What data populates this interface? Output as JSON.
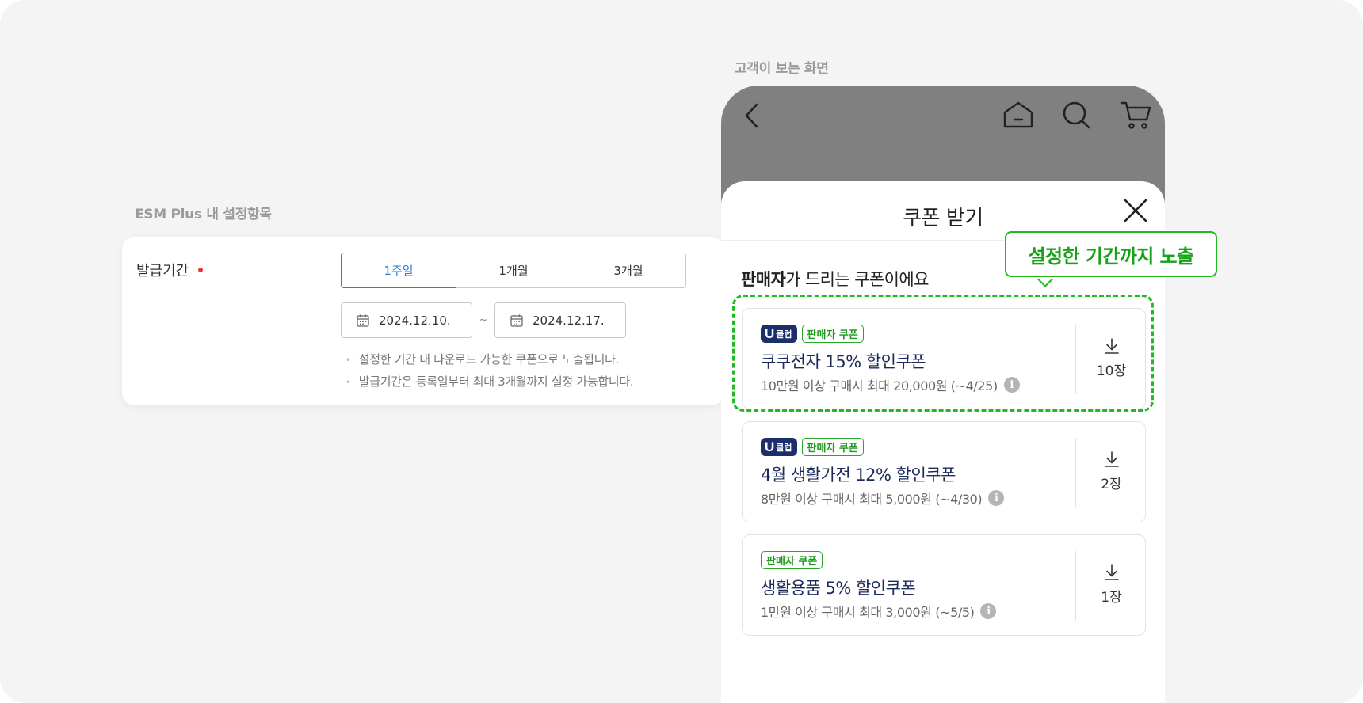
{
  "settings": {
    "caption": "ESM Plus 내 설정항목",
    "field_label": "발급기간",
    "period_options": [
      "1주일",
      "1개월",
      "3개월"
    ],
    "selected_period": "1주일",
    "start_date": "2024.12.10.",
    "date_separator": "~",
    "end_date": "2024.12.17.",
    "notes": [
      "설정한 기간 내 다운로드 가능한 쿠폰으로 노출됩니다.",
      "발급기간은 등록일부터 최대 3개월까지 설정 가능합니다."
    ]
  },
  "preview": {
    "caption": "고객이 보는 화면",
    "nav_icons": [
      "back-arrow-icon",
      "home-icon",
      "search-icon",
      "cart-icon"
    ],
    "sheet_title": "쿠폰 받기",
    "subtitle_bold": "판매자",
    "subtitle_rest": "가 드리는 쿠폰이에요",
    "coupons": [
      {
        "uclub_badge": "클럽",
        "seller_badge": "판매자 쿠폰",
        "name": "쿠쿠전자 15% 할인쿠폰",
        "desc": "10만원 이상 구매시 최대 20,000원 (~4/25)",
        "count": "10장"
      },
      {
        "uclub_badge": "클럽",
        "seller_badge": "판매자 쿠폰",
        "name": "4월 생활가전 12% 할인쿠폰",
        "desc": "8만원 이상 구매시 최대 5,000원 (~4/30)",
        "count": "2장"
      },
      {
        "seller_badge": "판매자 쿠폰",
        "name": "생활용품 5% 할인쿠폰",
        "desc": "1만원 이상 구매시 최대 3,000원 (~5/5)",
        "count": "1장"
      }
    ]
  },
  "annotation": {
    "callout": "설정한 기간까지 노출",
    "color": "#1fbb1f"
  },
  "colors": {
    "accent": "#2b7de1",
    "required": "#e53935",
    "uclub": "#1b2f6b"
  }
}
